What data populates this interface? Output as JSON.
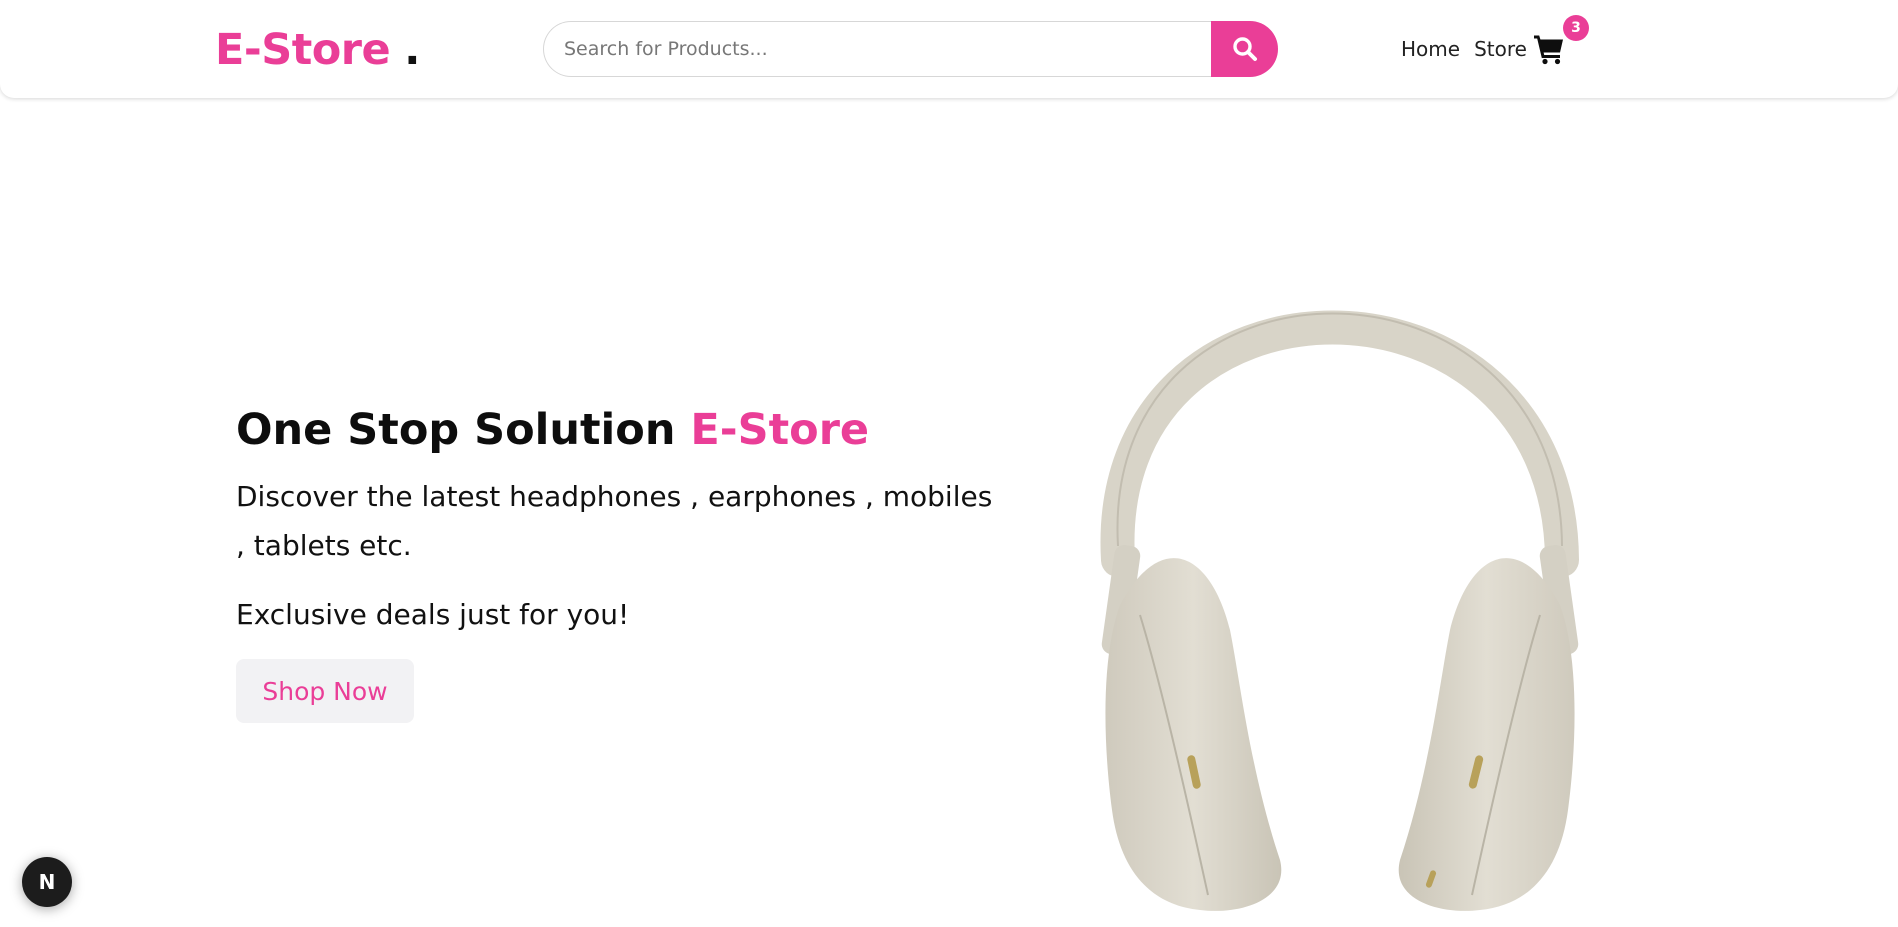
{
  "header": {
    "brand": {
      "name": "E-Store",
      "dot": "."
    },
    "search": {
      "placeholder": "Search for Products...",
      "value": ""
    },
    "search_button_icon": "search-icon",
    "nav": [
      {
        "label": "Home"
      },
      {
        "label": "Store"
      }
    ],
    "cart": {
      "icon": "shopping-cart-icon",
      "count": "3"
    }
  },
  "hero": {
    "title_prefix": "One Stop Solution",
    "title_accent": "E-Store",
    "description": "Discover the latest headphones , earphones , mobiles , tablets etc.",
    "deals": "Exclusive deals just for you!",
    "cta_label": "Shop Now",
    "image": "over-ear-headphones"
  },
  "dev_badge": {
    "letter": "N",
    "icon": "nextjs-icon"
  },
  "colors": {
    "accent": "#ea3e97",
    "text": "#111111",
    "button_bg": "#f2f2f4",
    "headphone": "#dcd8cd"
  }
}
